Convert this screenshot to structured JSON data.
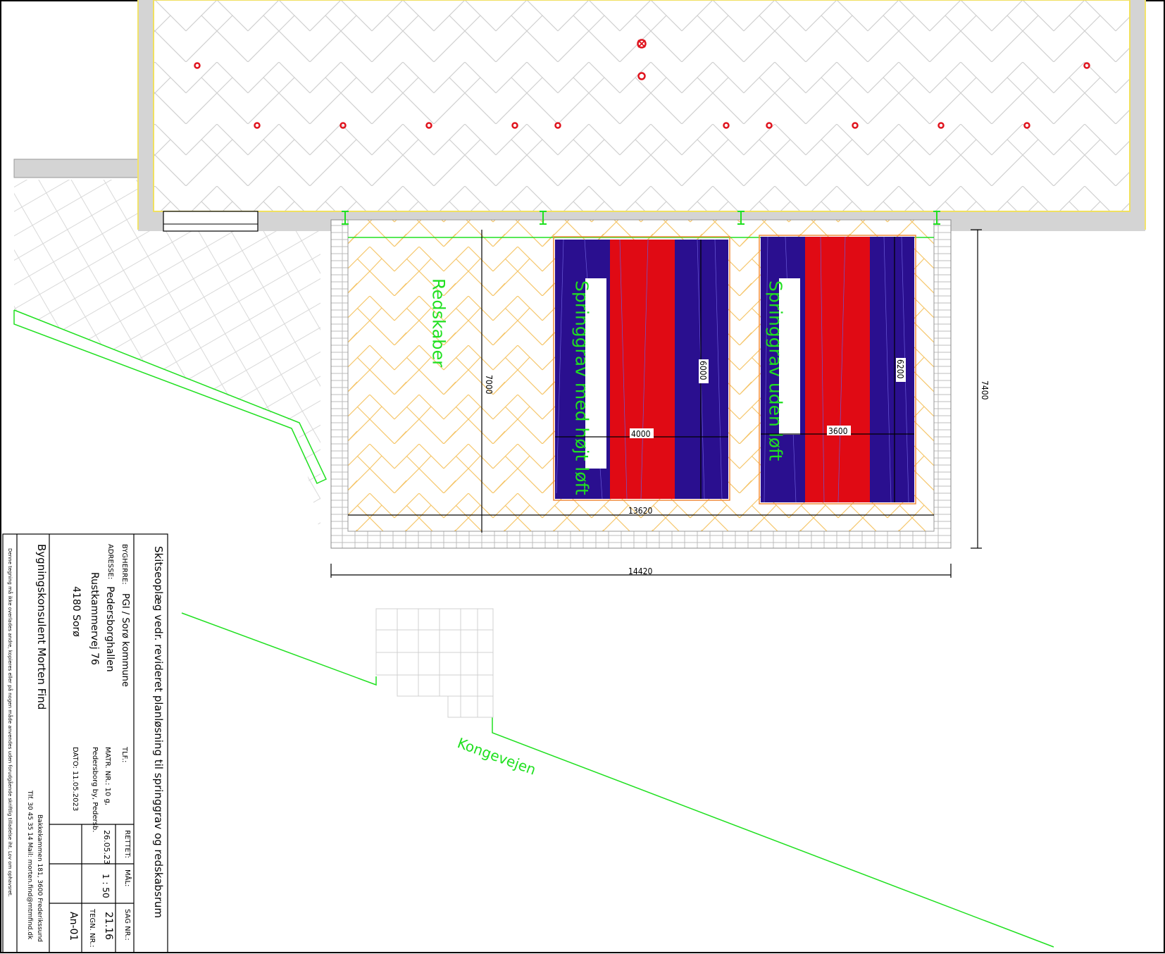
{
  "drawing": {
    "area_labels": {
      "tool_room": "Redskaber",
      "pit_high": "Springgrav med højt løft",
      "pit_low": "Springgrav uden løft",
      "road": "Kongevejen"
    },
    "dimensions": {
      "pit_high_width": "4000",
      "pit_high_length": "6000",
      "pit_low_width": "3600",
      "pit_low_length": "6200",
      "inner_width": "13620",
      "outer_width": "14420",
      "inner_depth": "7000",
      "outer_depth": "7400"
    },
    "colors": {
      "pit_blue": "#2a0f8f",
      "pit_red": "#e00a14",
      "green_line": "#20e020",
      "hatch_orange": "#f5c66a",
      "wall_gray": "#d4d4d4",
      "marker_red": "#e0141e"
    }
  },
  "title_block": {
    "title": "Skitseoplæg vedr. revideret planløsning til springgrav og redskabsrum",
    "bygherre_label": "BYGHERRE:",
    "bygherre_value": "PGI / Sorø kommune",
    "tlf_label": "TLF.:",
    "adresse_label": "ADRESSE:",
    "adresse_line1": "Pedersborghallen",
    "adresse_line2": "Rustkammervej 76",
    "adresse_line3": "4180 Sorø",
    "matr_label": "MATR. NR.: 10 g,",
    "matr_value": "Pedersborg by, Pedersb.",
    "dato": "DATO: 11.05.2023",
    "rettet_label": "RETTET:",
    "rettet_value": "26.05.23",
    "maal_label": "MÅL:",
    "maal_value": "1 : 50",
    "sag_label": "SAG NR.:",
    "sag_value": "21.16",
    "tegn_label": "TEGN. NR.:",
    "tegn_value": "An-01",
    "company": "Bygningskonsulent Morten Find",
    "company_address": "Bakkekammen 181, 3600 Frederikssund",
    "company_contact": "Tlf. 30 45 35 14 Mail: morten.find@mtmfind.dk",
    "disclaimer": "Denne tegning må ikke overlades andre, kopieres eller på nogen måde anvendes uden forudgående skriftlig tilladelse iht. Lov om ophavsret."
  }
}
